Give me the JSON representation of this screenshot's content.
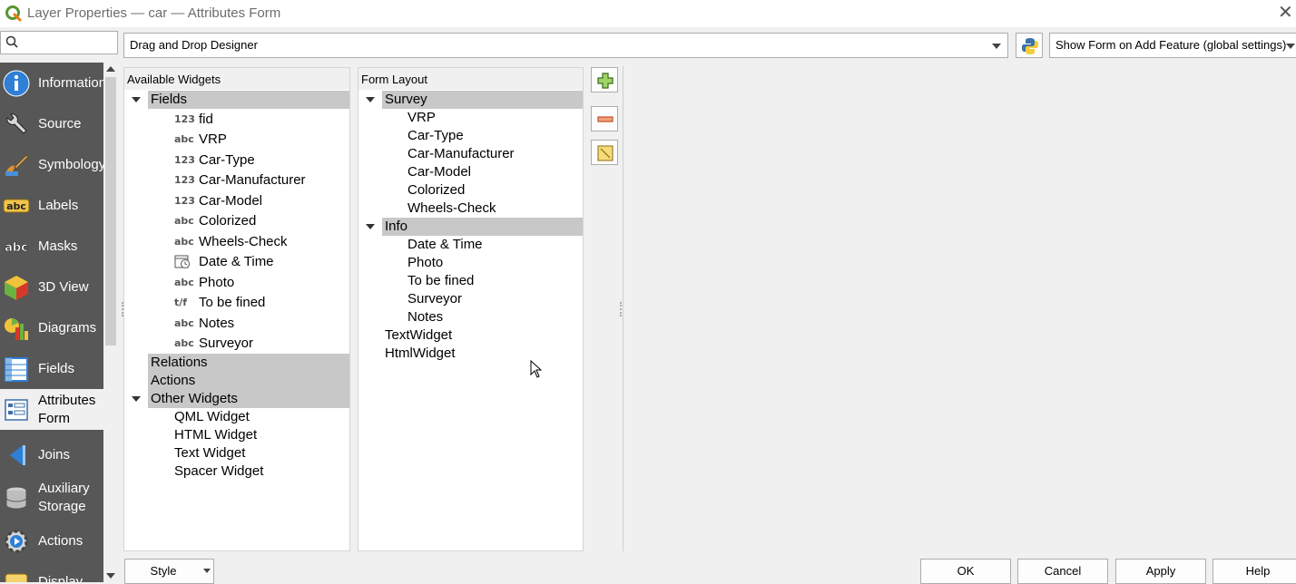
{
  "window": {
    "title": "Layer Properties — car — Attributes Form",
    "close_glyph": "✕"
  },
  "search": {
    "value": "",
    "placeholder": ""
  },
  "sidebar": {
    "items": [
      {
        "label": "Information",
        "icon": "info-icon"
      },
      {
        "label": "Source",
        "icon": "wrench-icon"
      },
      {
        "label": "Symbology",
        "icon": "brush-icon"
      },
      {
        "label": "Labels",
        "icon": "labels-abc-icon"
      },
      {
        "label": "Masks",
        "icon": "masks-abc-icon"
      },
      {
        "label": "3D View",
        "icon": "cube-icon"
      },
      {
        "label": "Diagrams",
        "icon": "diagram-icon"
      },
      {
        "label": "Fields",
        "icon": "fields-table-icon"
      },
      {
        "label": "Attributes\nForm",
        "label_line1": "Attributes",
        "label_line2": "Form",
        "icon": "form-icon",
        "active": true
      },
      {
        "label": "Joins",
        "icon": "joins-icon"
      },
      {
        "label_line1": "Auxiliary",
        "label_line2": "Storage",
        "icon": "database-icon"
      },
      {
        "label": "Actions",
        "icon": "actions-gear-icon"
      },
      {
        "label": "Display",
        "icon": "display-icon"
      }
    ]
  },
  "toolbar": {
    "designer_combo": "Drag and Drop Designer",
    "python_icon": "python-icon",
    "showform_combo": "Show Form on Add Feature (global settings)"
  },
  "available_widgets": {
    "header": "Available Widgets",
    "fields_group": "Fields",
    "fields": [
      {
        "type": "123",
        "name": "fid"
      },
      {
        "type": "abc",
        "name": "VRP"
      },
      {
        "type": "123",
        "name": "Car-Type"
      },
      {
        "type": "123",
        "name": "Car-Manufacturer"
      },
      {
        "type": "123",
        "name": "Car-Model"
      },
      {
        "type": "abc",
        "name": "Colorized"
      },
      {
        "type": "abc",
        "name": "Wheels-Check"
      },
      {
        "type": "datetime-icon",
        "name": "Date & Time"
      },
      {
        "type": "abc",
        "name": "Photo"
      },
      {
        "type": "t/f",
        "name": "To be fined"
      },
      {
        "type": "abc",
        "name": "Notes"
      },
      {
        "type": "abc",
        "name": "Surveyor"
      }
    ],
    "relations_group": "Relations",
    "actions_group": "Actions",
    "other_group": "Other Widgets",
    "other": [
      "QML Widget",
      "HTML Widget",
      "Text Widget",
      "Spacer Widget"
    ]
  },
  "form_layout": {
    "header": "Form Layout",
    "survey_group": "Survey",
    "survey_items": [
      "VRP",
      "Car-Type",
      "Car-Manufacturer",
      "Car-Model",
      "Colorized",
      "Wheels-Check"
    ],
    "info_group": "Info",
    "info_items": [
      "Date & Time",
      "Photo",
      "To be fined",
      "Surveyor",
      "Notes"
    ],
    "root_items": [
      "TextWidget",
      "HtmlWidget"
    ]
  },
  "footer": {
    "style": "Style",
    "ok": "OK",
    "cancel": "Cancel",
    "apply": "Apply",
    "help": "Help"
  },
  "colors": {
    "sidebar_bg": "#575757",
    "group_bg": "#c8c8c8",
    "qgis_green": "#589632"
  }
}
